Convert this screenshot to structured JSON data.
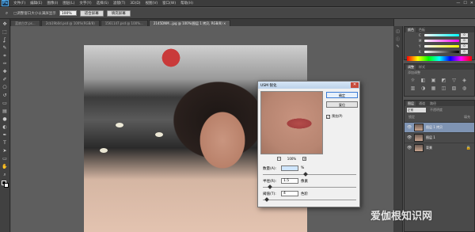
{
  "menubar": {
    "logo": "Ps",
    "items": [
      "文件(F)",
      "编辑(E)",
      "图像(I)",
      "图层(L)",
      "文字(Y)",
      "选择(S)",
      "滤镜(T)",
      "3D(D)",
      "视图(V)",
      "窗口(W)",
      "帮助(H)"
    ],
    "window_controls": [
      "—",
      "☐",
      "✕"
    ]
  },
  "optionsbar": {
    "checkbox_label": "□调整窗口大小以满屏显示",
    "zoom_value": "100%",
    "fit_button": "适合屏幕",
    "fill_button": "填充屏幕"
  },
  "tabs": [
    {
      "label": "蓝底白字.ps...",
      "active": false
    },
    {
      "label": "2cb19b0d.psd @ 100%(RGB/8)",
      "active": false
    },
    {
      "label": "1561147.psd @ 100%...",
      "active": false
    },
    {
      "label": "2145DNM...jpg @ 100%(图层 1 拷贝, RGB/8) ×",
      "active": true
    }
  ],
  "toolbar_icons": [
    "move-icon",
    "marquee-icon",
    "lasso-icon",
    "quick-select-icon",
    "crop-icon",
    "eyedropper-icon",
    "healing-icon",
    "brush-icon",
    "stamp-icon",
    "history-brush-icon",
    "eraser-icon",
    "gradient-icon",
    "blur-icon",
    "dodge-icon",
    "pen-icon",
    "type-icon",
    "path-select-icon",
    "shape-icon",
    "hand-icon",
    "zoom-icon"
  ],
  "toolbar_glyphs": [
    "✥",
    "⬚",
    "ʆ",
    "✎",
    "⌗",
    "✑",
    "✚",
    "✐",
    "⎔",
    "↺",
    "▭",
    "▤",
    "●",
    "◐",
    "✒",
    "T",
    "➤",
    "▭",
    "✋",
    "⌕"
  ],
  "color_panel": {
    "tabs": [
      "颜色",
      "色板"
    ],
    "sliders": [
      {
        "label": "C",
        "value": "0"
      },
      {
        "label": "M",
        "value": "0"
      },
      {
        "label": "Y",
        "value": "0"
      },
      {
        "label": "K",
        "value": "0"
      }
    ]
  },
  "adjust_panel": {
    "tabs": [
      "调整",
      "样式"
    ],
    "title": "添加调整",
    "icons": [
      "☼",
      "◧",
      "▣",
      "◩",
      "▽",
      "◈",
      "▥",
      "◑",
      "▦",
      "◫",
      "▧",
      "◍"
    ]
  },
  "layers_panel": {
    "tabs": [
      "图层",
      "通道",
      "路径"
    ],
    "blend_mode": "正常",
    "opacity_label": "不透明度",
    "lock_label": "锁定",
    "fill_label": "填充",
    "layers": [
      {
        "name": "图层 1 拷贝",
        "selected": true
      },
      {
        "name": "图层 1",
        "selected": false
      },
      {
        "name": "背景",
        "selected": false,
        "locked": true
      }
    ]
  },
  "dialog": {
    "title": "USM 锐化",
    "close": "✕",
    "ok": "确定",
    "reset": "复位",
    "preview_label": "预览(P)",
    "preview_checked": "✓",
    "zoom": "100%",
    "zoom_minus": "−",
    "zoom_plus": "+",
    "amount_label": "数量(A):",
    "amount_value": "",
    "amount_unit": "%",
    "radius_label": "半径(R):",
    "radius_value": "1.5",
    "radius_unit": "像素",
    "threshold_label": "阈值(T):",
    "threshold_value": "4",
    "threshold_unit": "色阶"
  },
  "watermark": "爱伽根知识网",
  "colors": {
    "accent": "#3a7bd5",
    "selected_layer": "#7f94b3",
    "ps_blue": "#4ea8e8"
  }
}
